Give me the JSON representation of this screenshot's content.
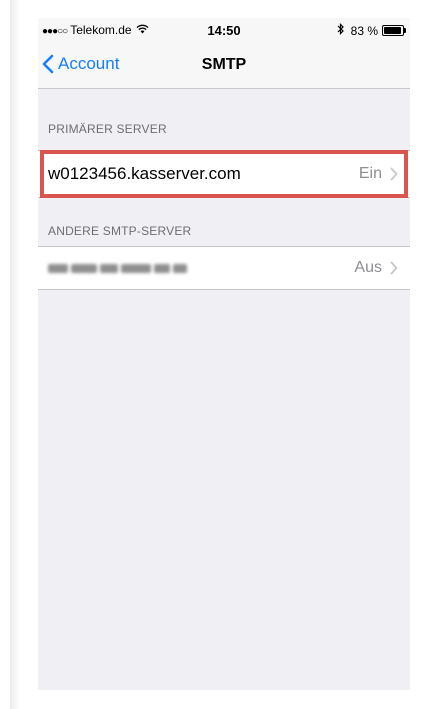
{
  "status_bar": {
    "signal_dots": "●●●○○",
    "carrier": "Telekom.de",
    "wifi_icon": "wifi-icon",
    "time": "14:50",
    "bluetooth_icon": "bluetooth-icon",
    "battery_percent": "83 %",
    "battery_level": 0.83
  },
  "nav": {
    "back_label": "Account",
    "title": "SMTP"
  },
  "sections": {
    "primary": {
      "header": "PRIMÄRER SERVER",
      "server_name": "w0123456.kasserver.com",
      "status": "Ein"
    },
    "other": {
      "header": "ANDERE SMTP-SERVER",
      "server_name_redacted": true,
      "status": "Aus"
    }
  },
  "colors": {
    "accent": "#157efb",
    "highlight_border": "#d9534f",
    "background": "#efeff4"
  }
}
